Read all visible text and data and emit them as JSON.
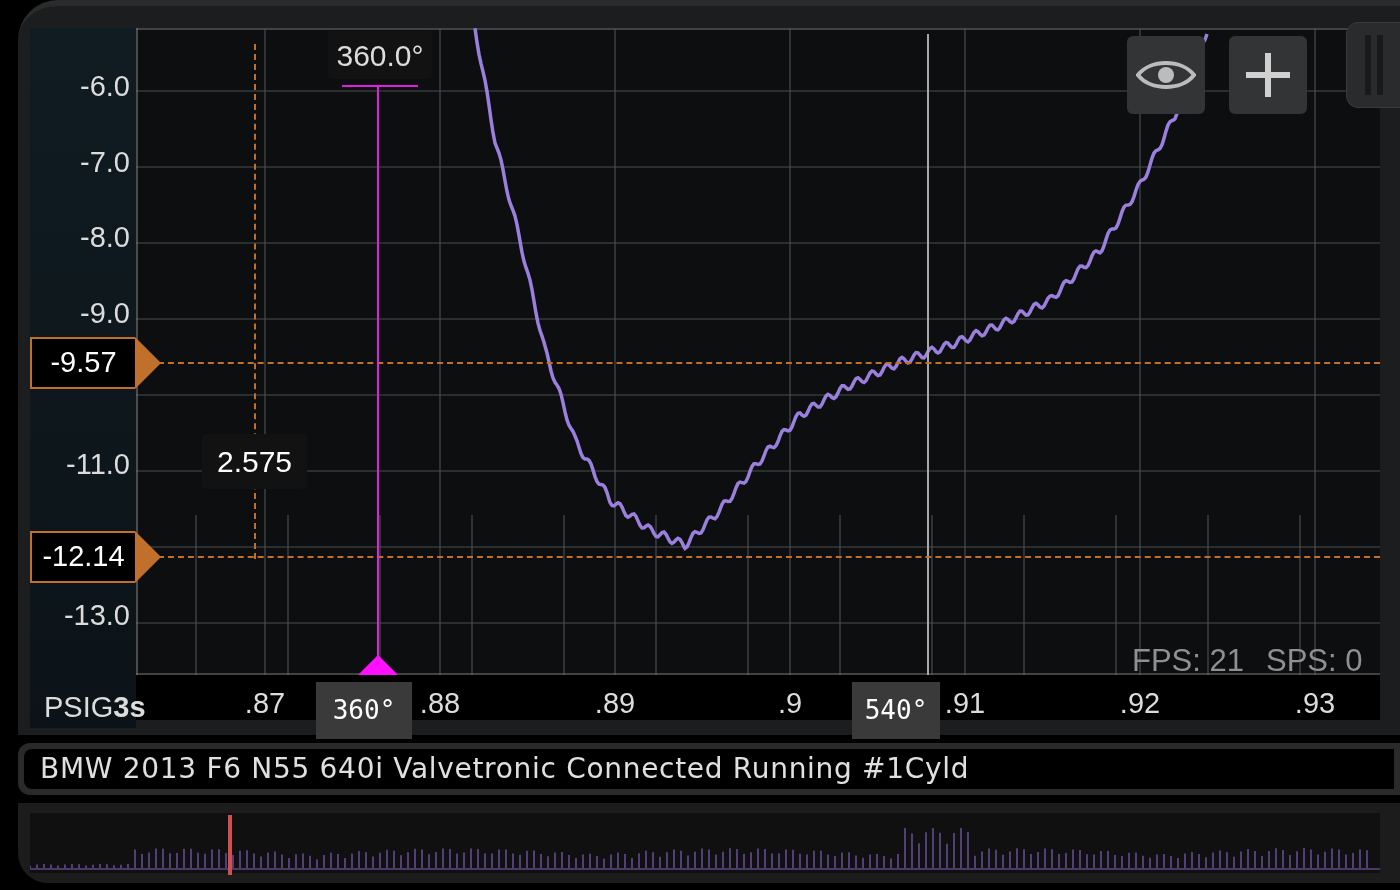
{
  "phase_cursor_top": {
    "label": "360.0°"
  },
  "y_axis": {
    "ticks": [
      "-6.0",
      "-7.0",
      "-8.0",
      "-9.0",
      "-11.0",
      "-13.0"
    ]
  },
  "horizontal_cursors": [
    {
      "value": "-9.57"
    },
    {
      "value": "-12.14"
    }
  ],
  "delta_label": "2.575",
  "stats": [
    "FPS: 21",
    "SPS: 0"
  ],
  "x_axis": {
    "unit": "PSIG",
    "time_base": "3s",
    "ticks": [
      ".87",
      ".88",
      ".89",
      ".9",
      ".91",
      ".92",
      ".93"
    ]
  },
  "phase_markers": [
    {
      "label": "360°"
    },
    {
      "label": "540°"
    }
  ],
  "title": "BMW 2013 F6 N55 640i Valvetronic Connected Running #1Cyld"
}
